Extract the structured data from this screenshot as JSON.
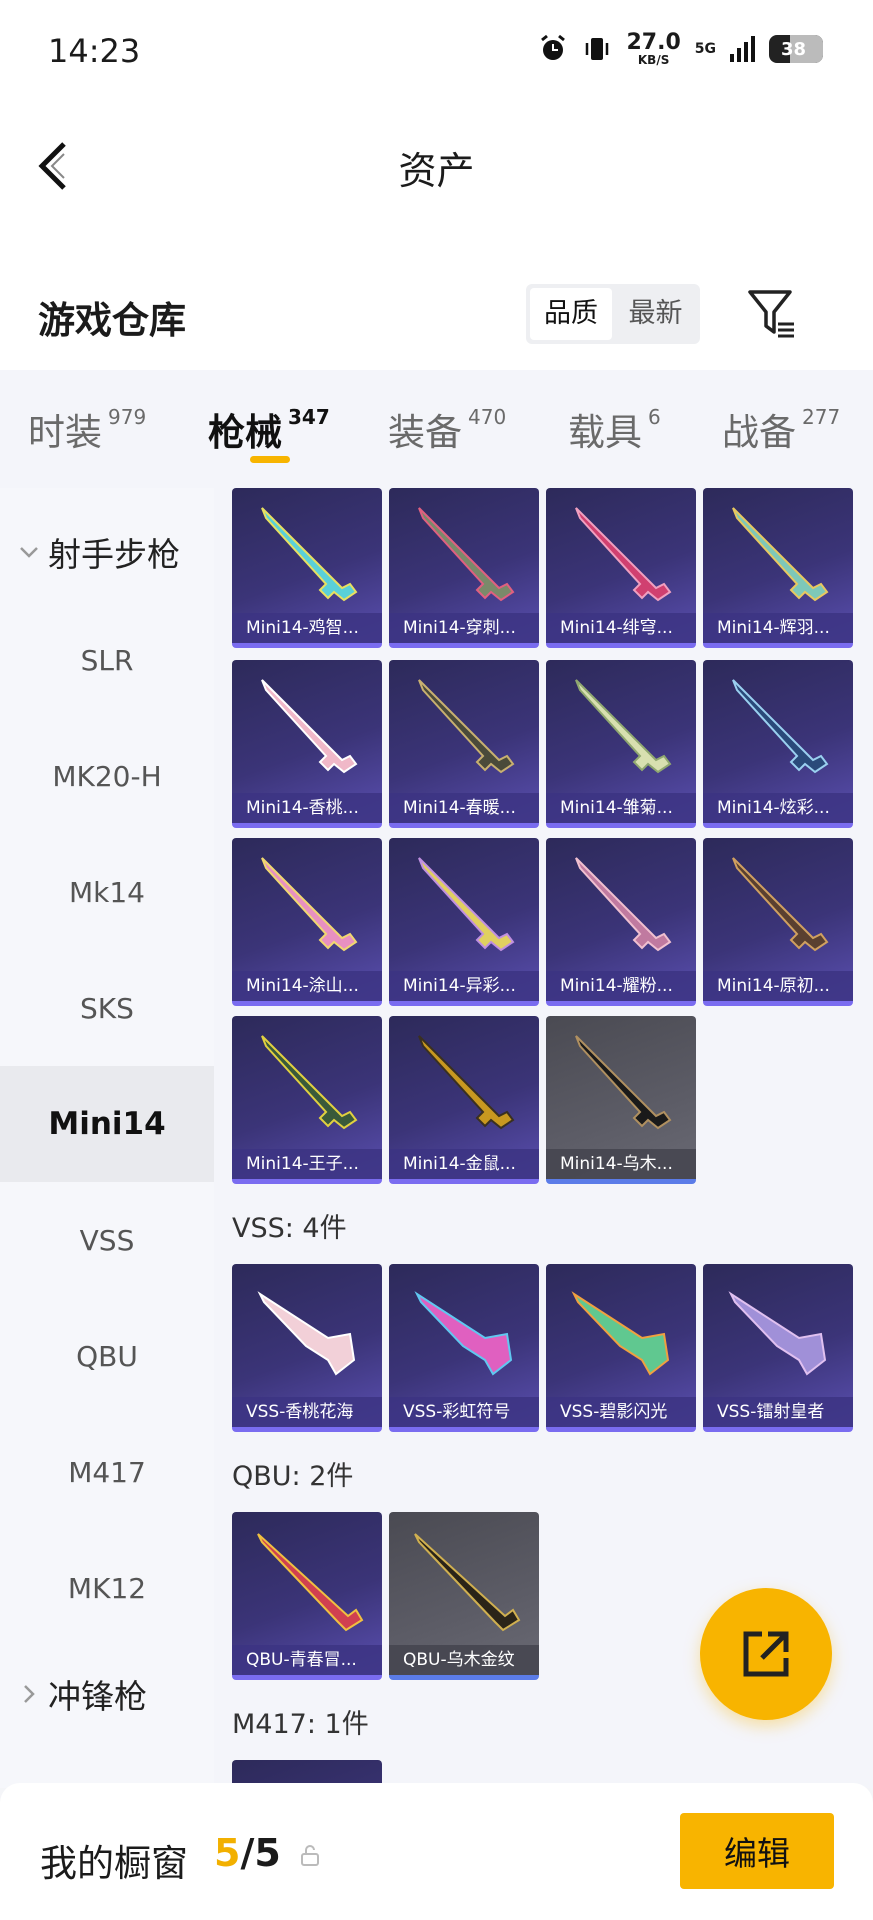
{
  "status_bar": {
    "time": "14:23",
    "speed_value": "27.0",
    "speed_unit": "KB/S",
    "network": "5G",
    "battery": "38",
    "battery_level_percent": 38
  },
  "header": {
    "title": "资产",
    "back_icon": "chevron-left-icon"
  },
  "warehouse": {
    "title": "游戏仓库",
    "sort_options": [
      "品质",
      "最新"
    ],
    "sort_selected": "品质",
    "filter_icon": "filter-icon"
  },
  "tabs": [
    {
      "label": "时装",
      "count": "979"
    },
    {
      "label": "枪械",
      "count": "347",
      "active": true
    },
    {
      "label": "装备",
      "count": "470"
    },
    {
      "label": "载具",
      "count": "6"
    },
    {
      "label": "战备",
      "count": "277"
    }
  ],
  "sidebar": {
    "category_open": "射手步枪",
    "items": [
      "SLR",
      "MK20-H",
      "Mk14",
      "SKS",
      "Mini14",
      "VSS",
      "QBU",
      "M417",
      "MK12"
    ],
    "active_item": "Mini14",
    "category_closed": "冲锋枪"
  },
  "mini14_cards": [
    "Mini14-鸡智...",
    "Mini14-穿刺...",
    "Mini14-绯穹...",
    "Mini14-辉羽...",
    "Mini14-香桃...",
    "Mini14-春暖...",
    "Mini14-雏菊...",
    "Mini14-炫彩...",
    "Mini14-涂山...",
    "Mini14-异彩...",
    "Mini14-耀粉...",
    "Mini14-原初...",
    "Mini14-王子...",
    "Mini14-金鼠...",
    "Mini14-乌木..."
  ],
  "vss_section": {
    "label": "VSS: 4件",
    "cards": [
      "VSS-香桃花海",
      "VSS-彩虹符号",
      "VSS-碧影闪光",
      "VSS-镭射皇者"
    ]
  },
  "qbu_section": {
    "label": "QBU: 2件",
    "cards": [
      "QBU-青春冒...",
      "QBU-乌木金纹"
    ]
  },
  "m417_section": {
    "label": "M417: 1件"
  },
  "fab": {
    "icon": "share-external-icon"
  },
  "showcase": {
    "label": "我的橱窗",
    "current": "5",
    "separator": "/",
    "total": "5",
    "lock_icon": "lock-icon",
    "edit_button": "编辑"
  },
  "colors": {
    "accent": "#f8b400",
    "card_purple": "#3b3478",
    "card_gray": "#5c5c66"
  }
}
